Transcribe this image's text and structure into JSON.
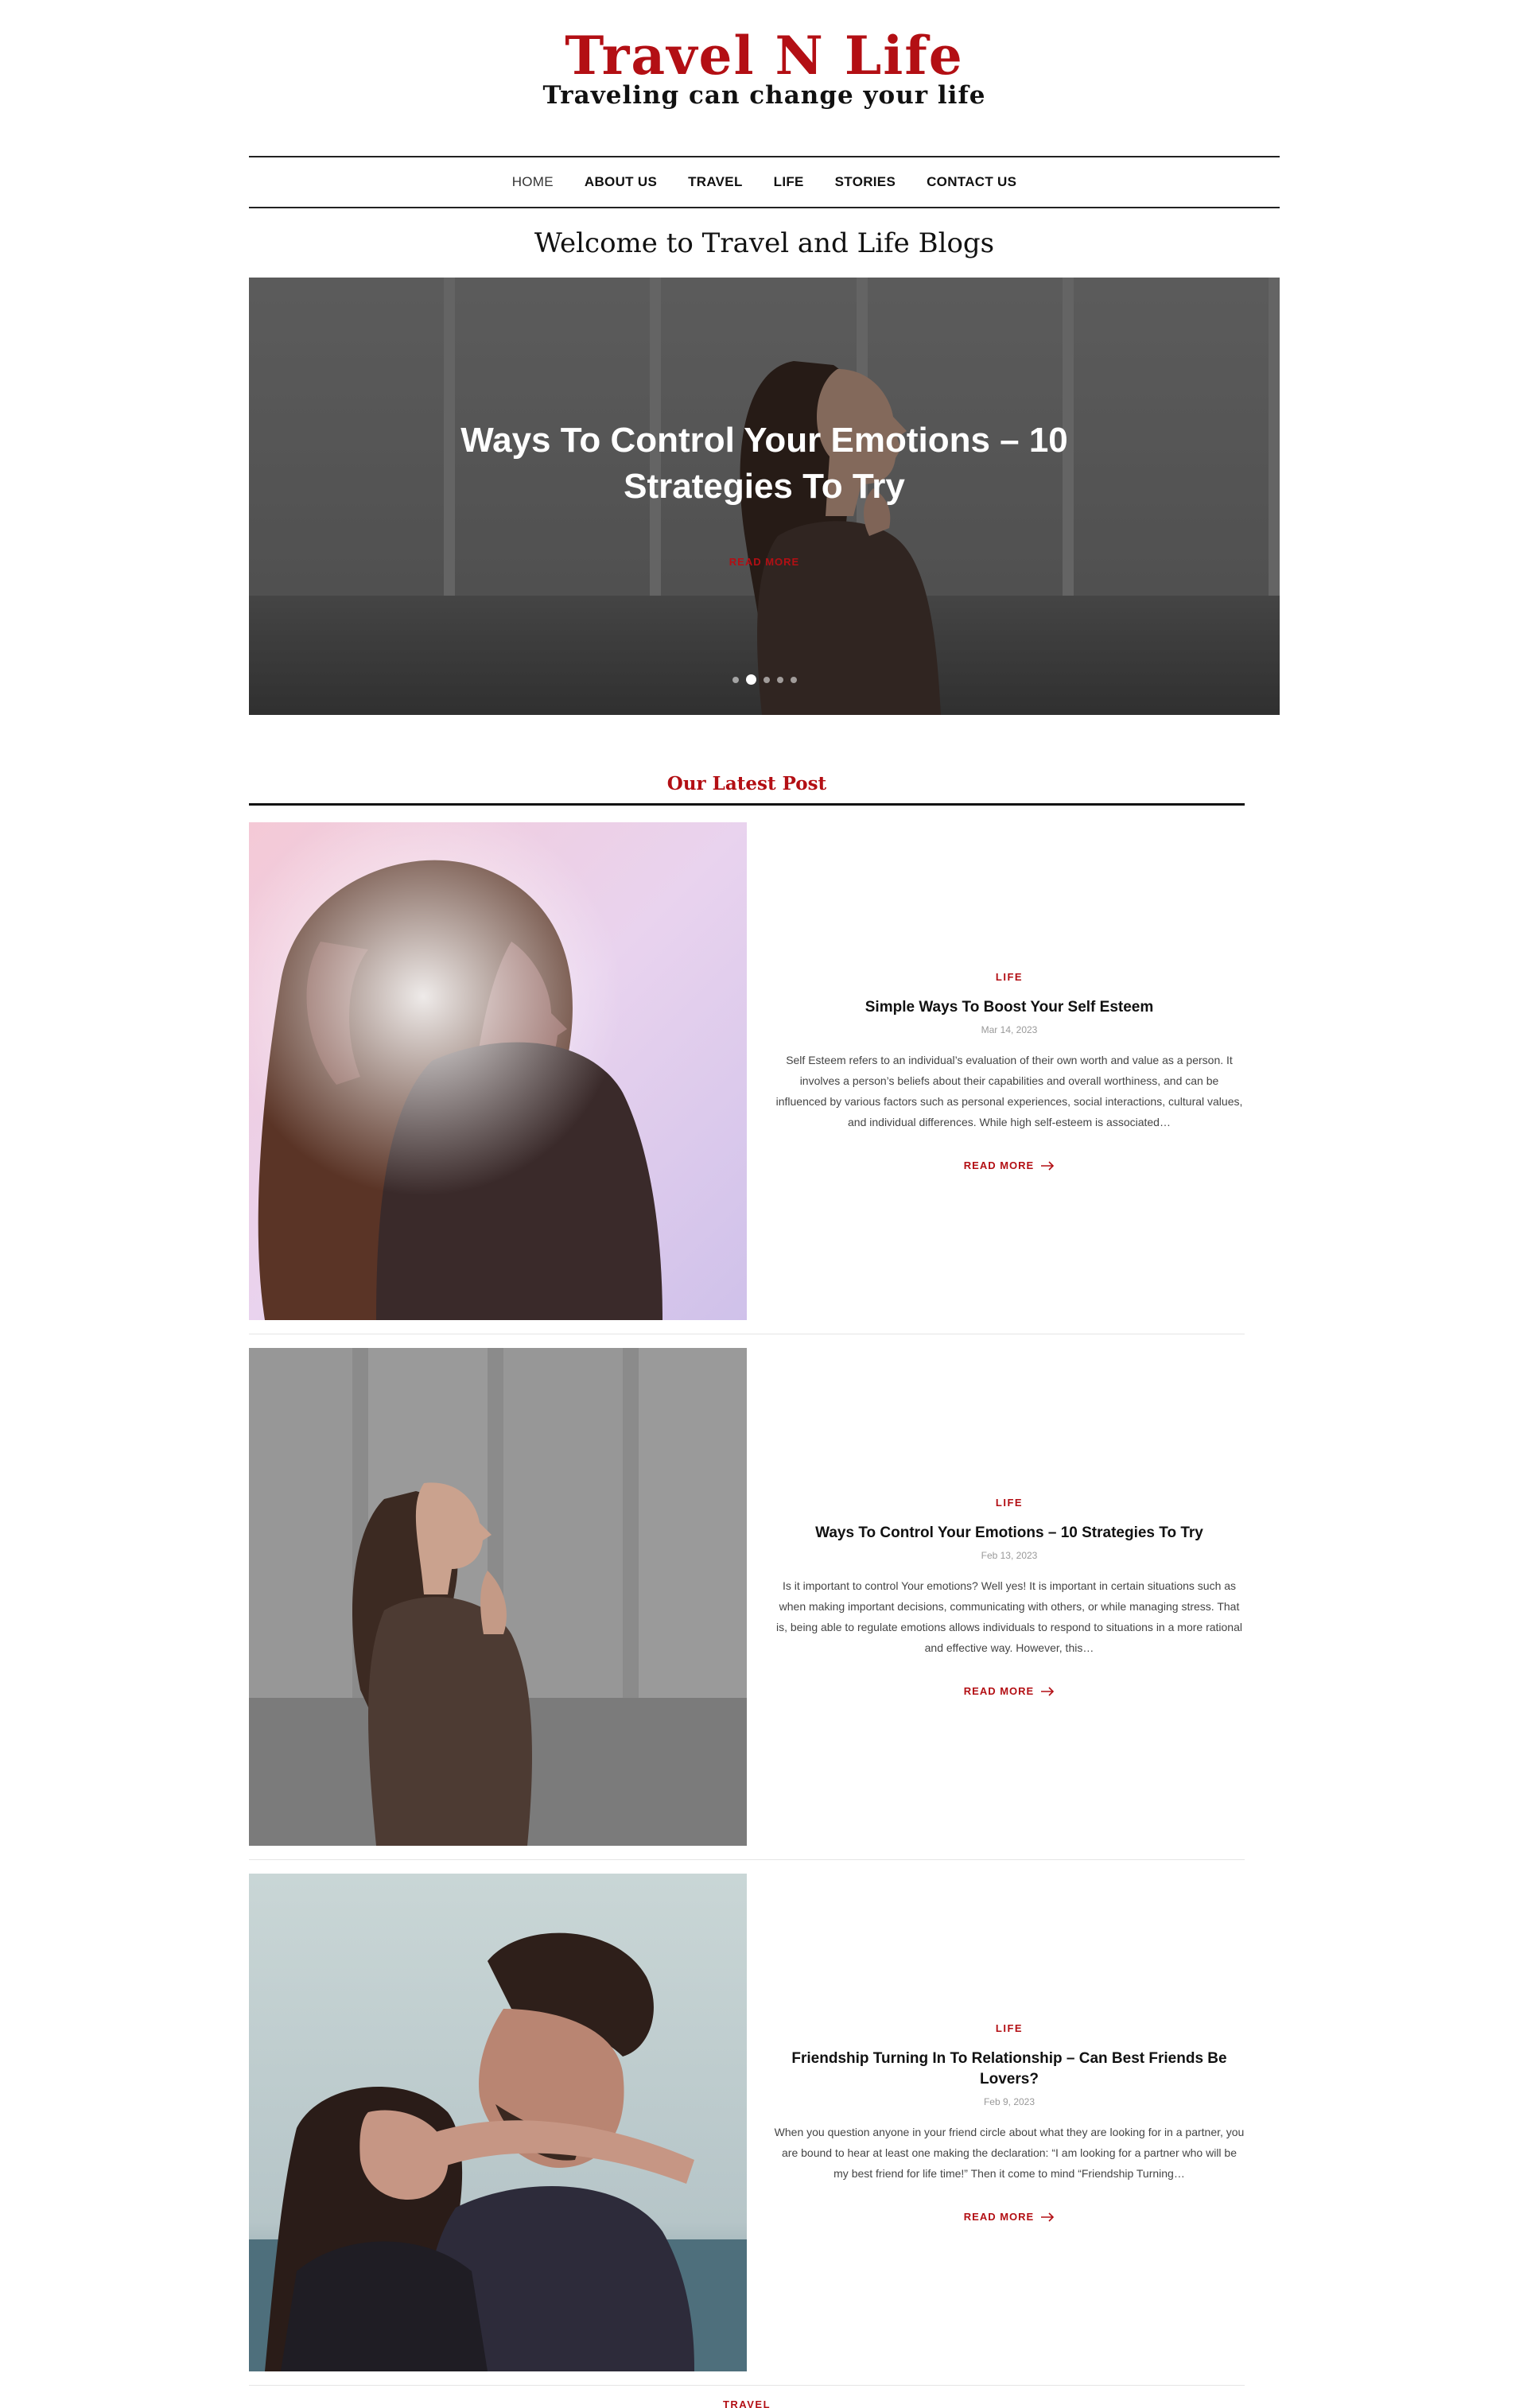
{
  "site": {
    "title": "Travel N Life",
    "tagline": "Traveling can change your life"
  },
  "nav": {
    "items": [
      {
        "label": "HOME"
      },
      {
        "label": "ABOUT US"
      },
      {
        "label": "TRAVEL"
      },
      {
        "label": "LIFE"
      },
      {
        "label": "STORIES"
      },
      {
        "label": "CONTACT US"
      }
    ],
    "active": "HOME"
  },
  "welcome": "Welcome to Travel and Life Blogs",
  "hero": {
    "title": "Ways To Control Your Emotions – 10 Strategies To Try",
    "read_more": "READ MORE",
    "slides_count": 5,
    "active_slide": 2
  },
  "latest": {
    "heading": "Our Latest Post",
    "posts": [
      {
        "category": "LIFE",
        "title": "Simple Ways To Boost Your Self Esteem",
        "date": "Mar 14, 2023",
        "excerpt": "Self Esteem refers to an individual’s evaluation of their own worth and value as a person. It involves a person’s beliefs about their capabilities and overall worthiness, and can be influenced by various factors such as personal experiences, social interactions, cultural values, and individual differences. While high self-esteem is associated…",
        "read_more": "READ MORE"
      },
      {
        "category": "LIFE",
        "title": "Ways To Control Your Emotions – 10 Strategies To Try",
        "date": "Feb 13, 2023",
        "excerpt": "Is it important to control Your emotions? Well yes! It is important in certain situations such as when making important decisions, communicating with others, or while managing stress. That is, being able to regulate emotions allows individuals to respond to situations in a more rational and effective way. However, this…",
        "read_more": "READ MORE"
      },
      {
        "category": "LIFE",
        "title": "Friendship Turning In To Relationship – Can Best Friends Be Lovers?",
        "date": "Feb 9, 2023",
        "excerpt": "When you question anyone in your friend circle about what they are looking for in a partner, you are bound to hear at least one making the declaration: “I am looking for a partner who will be my best friend for life time!” Then it come to mind “Friendship Turning…",
        "read_more": "READ MORE"
      }
    ],
    "next_category": "TRAVEL"
  },
  "colors": {
    "brand": "#b30f14",
    "text": "#111111"
  },
  "icons": {
    "read_more": "arrow-right-icon"
  }
}
